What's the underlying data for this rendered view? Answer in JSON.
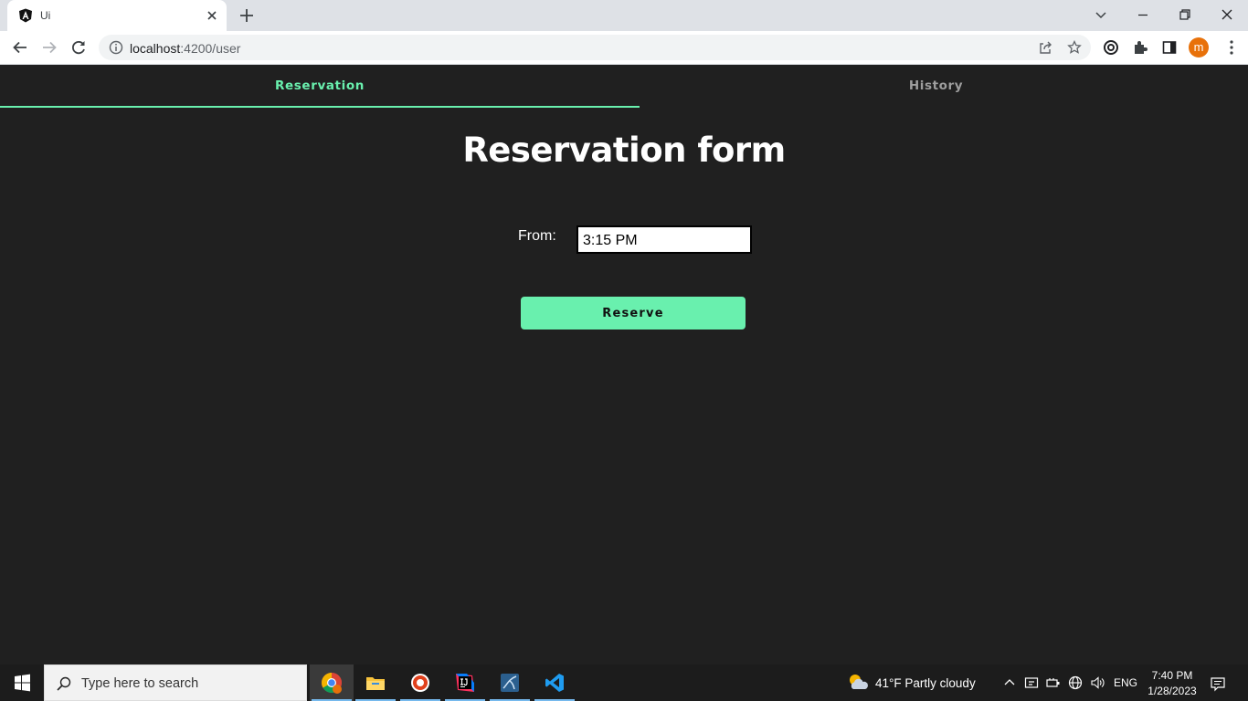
{
  "browser": {
    "tab_title": "Ui",
    "url_host": "localhost",
    "url_path": ":4200/user",
    "profile_initial": "m"
  },
  "app": {
    "tabs": [
      {
        "label": "Reservation",
        "active": true
      },
      {
        "label": "History",
        "active": false
      }
    ],
    "accent_color": "#69f0ae",
    "background_color": "#202020",
    "form": {
      "title": "Reservation form",
      "from_label": "From:",
      "from_value": "3:15 PM",
      "submit_label": "Reserve"
    }
  },
  "taskbar": {
    "search_placeholder": "Type here to search",
    "weather": "41°F  Partly cloudy",
    "language": "ENG",
    "time": "7:40 PM",
    "date": "1/28/2023",
    "apps": [
      "chrome-icon",
      "file-explorer-icon",
      "record-app-icon",
      "intellij-icon",
      "mysql-workbench-icon",
      "vscode-icon"
    ]
  }
}
